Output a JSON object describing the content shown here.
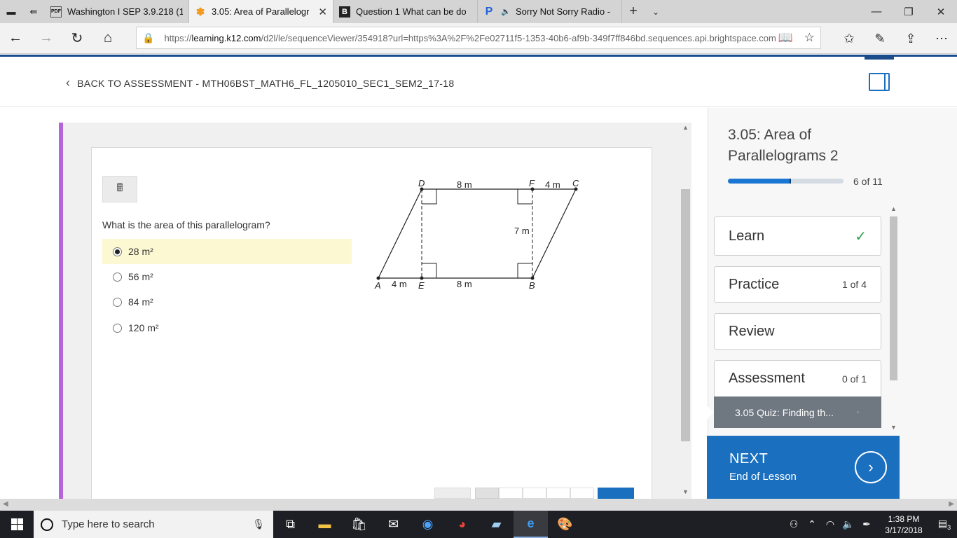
{
  "browser": {
    "tabs": [
      {
        "title": "Washington I SEP 3.9.218 (1",
        "icon": "pdf-icon",
        "active": false
      },
      {
        "title": "3.05: Area of Parallelogr",
        "icon": "k12-icon",
        "active": true
      },
      {
        "title": "Question 1 What can be do",
        "icon": "brainly-icon",
        "active": false
      },
      {
        "title": "Sorry Not Sorry Radio -",
        "icon": "pandora-icon",
        "active": false
      }
    ],
    "url_prefix": "https://",
    "url_domain": "learning.k12.com",
    "url_rest": "/d2l/le/sequenceViewer/354918?url=https%3A%2F%2Fe02711f5-1353-40b6-af9b-349f7ff846bd.sequences.api.brightspace.com"
  },
  "header": {
    "back_label": "BACK TO ASSESSMENT - MTH06BST_MATH6_FL_1205010_SEC1_SEM2_17-18"
  },
  "question": {
    "text": "What is the area of this parallelogram?",
    "choices": [
      "28 m²",
      "56 m²",
      "84 m²",
      "120 m²"
    ],
    "selected_index": 0
  },
  "diagram": {
    "points": {
      "A": "A",
      "B": "B",
      "C": "C",
      "D": "D",
      "E": "E",
      "F": "F"
    },
    "labels": {
      "top": "8 m",
      "top_right": "4 m",
      "height": "7 m",
      "bottom_left": "4 m",
      "bottom": "8 m"
    }
  },
  "lesson": {
    "title": "3.05: Area of Parallelograms 2",
    "progress_label": "6 of 11",
    "progress_fraction": 0.545,
    "steps": [
      {
        "name": "Learn",
        "info": "✓"
      },
      {
        "name": "Practice",
        "info": "1 of 4"
      },
      {
        "name": "Review",
        "info": ""
      },
      {
        "name": "Assessment",
        "info": "0 of 1"
      }
    ],
    "subitem": "3.05 Quiz: Finding th...",
    "next_label": "NEXT",
    "next_sub": "End of Lesson"
  },
  "taskbar": {
    "search_placeholder": "Type here to search",
    "time": "1:38 PM",
    "date": "3/17/2018",
    "notifications": "3"
  },
  "colors": {
    "accent": "#1a6fbf",
    "purple": "#b466d9",
    "selected_bg": "#fbf8d2",
    "check": "#2e9b4e"
  }
}
